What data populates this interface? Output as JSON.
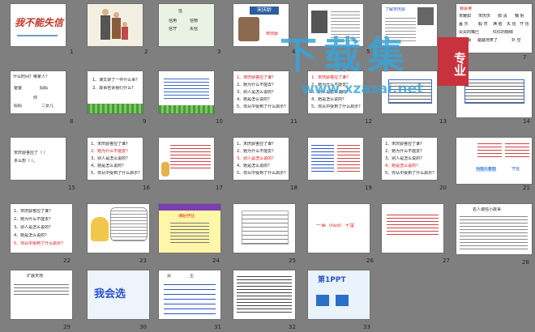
{
  "slides": [
    {
      "num": "1",
      "title": "我不能失信"
    },
    {
      "num": "2"
    },
    {
      "num": "3",
      "lines": [
        "信",
        "信用",
        "信物",
        "信守",
        "失信"
      ]
    },
    {
      "num": "4",
      "badge": "宋庆龄",
      "caption": "宋庆龄"
    },
    {
      "num": "5"
    },
    {
      "num": "6",
      "header": "了解宋庆龄"
    },
    {
      "num": "7",
      "header": "我会读",
      "words": [
        "宋耀如",
        "宋庆庆",
        "搞  清",
        "鞠 躬",
        "盖   乐",
        "毅 然",
        "满 脸",
        "失 信",
        "守 信",
        "尖尖的嘴巴",
        "红红的眼睛",
        "静悄悄",
        "踮踮地笑了",
        "扑 空"
      ]
    },
    {
      "num": "8",
      "lines": [
        "什么时间？哪家人？",
        "爸爸",
        "妈妈",
        "你",
        "妈妈",
        "二女儿"
      ]
    },
    {
      "num": "9",
      "lines": [
        "1、课文讲了一件什么事？",
        "2、故事告诉我们什么？"
      ]
    },
    {
      "num": "10"
    },
    {
      "num": "11",
      "lines": [
        "1、宋庆龄答应了谁？",
        "2、她为什么不能去？",
        "3、别人是怎么说的？",
        "4、她是怎么说的？",
        "5、你从中受到了什么启示？"
      ]
    },
    {
      "num": "12",
      "lines": [
        "1、宋庆龄答应了谁？",
        "2、她为什么不能去？",
        "3、别人是怎么说的？",
        "4、她是怎么说的？",
        "5、你从中受到了什么启示？"
      ]
    },
    {
      "num": "13"
    },
    {
      "num": "14"
    },
    {
      "num": "15",
      "lines": [
        "宋庆龄答应了（ ）",
        "多么想（ ）。"
      ]
    },
    {
      "num": "16",
      "lines": [
        "1、宋庆龄答应了谁？",
        "2、她为什么不能去？",
        "3、别人是怎么说的？",
        "4、她是怎么说的？",
        "5、你从中受到了什么启示？"
      ]
    },
    {
      "num": "17"
    },
    {
      "num": "18",
      "lines": [
        "1、宋庆龄答应了谁？",
        "2、她为什么不能去？",
        "3、别人是怎么说的？",
        "4、她是怎么说的？",
        "5、你从中受到了什么启示？"
      ]
    },
    {
      "num": "19"
    },
    {
      "num": "20",
      "lines": [
        "1、宋庆龄答应了谁？",
        "2、她为什么不能去？",
        "3、别人是怎么说的？",
        "4、她是怎么说的？",
        "5、你从中受到了什么启示？"
      ]
    },
    {
      "num": "21",
      "lines": [
        "为他人着想",
        "守信"
      ]
    },
    {
      "num": "22",
      "lines": [
        "1、宋庆龄答应了谁？",
        "2、她为什么不能去？",
        "3、别人是怎么说的？",
        "4、她是怎么说的？",
        "5、你从中受到了什么启示？"
      ]
    },
    {
      "num": "23"
    },
    {
      "num": "24",
      "lines": [
        "课后作业"
      ]
    },
    {
      "num": "25"
    },
    {
      "num": "26",
      "lines": [
        "一诺（nuò）千金"
      ]
    },
    {
      "num": "27"
    },
    {
      "num": "28",
      "lines": [
        "名人诚信小故事"
      ]
    },
    {
      "num": "29",
      "lines": [
        "扩展天地"
      ]
    },
    {
      "num": "30",
      "title": "我会选"
    },
    {
      "num": "31",
      "lines": [
        "尖",
        "尘"
      ]
    },
    {
      "num": "32"
    },
    {
      "num": "33",
      "logo": "第1PPT"
    }
  ],
  "watermark": {
    "line1": "下载集",
    "line2": "www.xzazai.net",
    "badge": "专业"
  },
  "colors": {
    "background": "#7f7f7f",
    "watermark": "#3aa3d8",
    "badge": "#c8323c"
  }
}
